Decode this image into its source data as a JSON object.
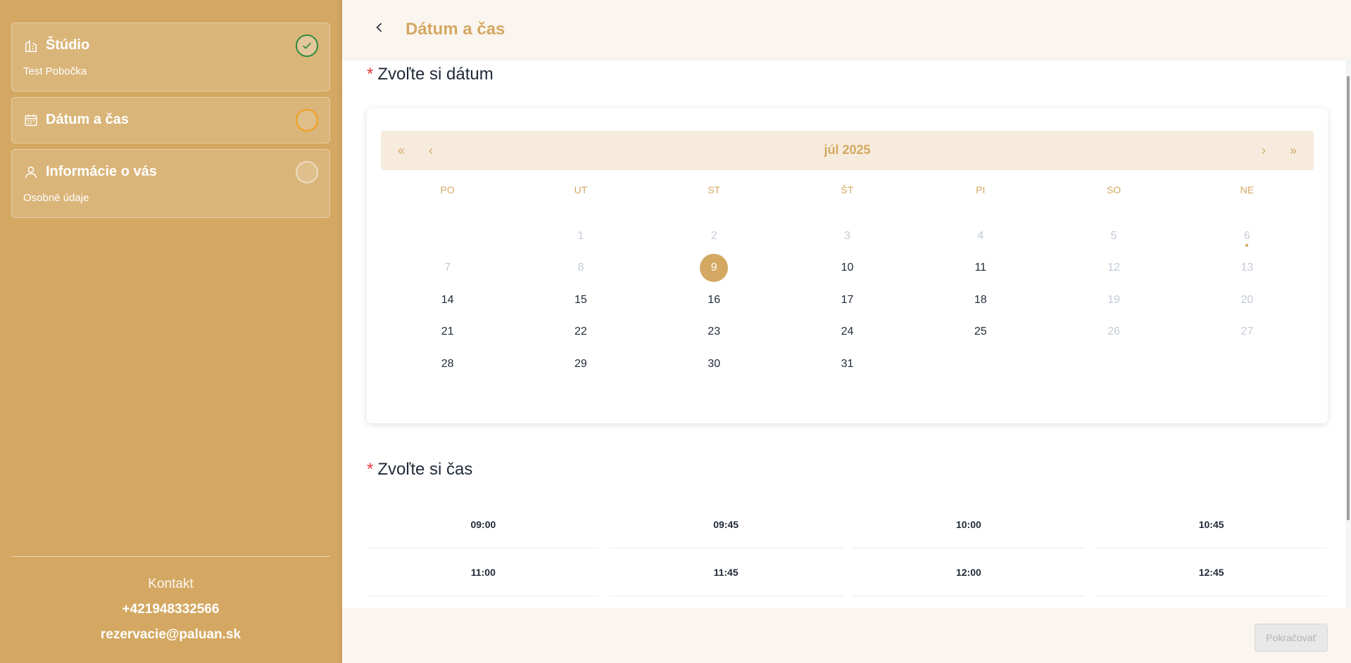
{
  "sidebar": {
    "steps": [
      {
        "title": "Štúdio",
        "subtitle": "Test Pobočka",
        "icon": "building-icon",
        "status": "done"
      },
      {
        "title": "Dátum a čas",
        "subtitle": "",
        "icon": "calendar-icon",
        "status": "active"
      },
      {
        "title": "Informácie o vás",
        "subtitle": "Osobné údaje",
        "icon": "user-icon",
        "status": "todo"
      }
    ],
    "contact": {
      "title": "Kontakt",
      "phone": "+421948332566",
      "email": "rezervacie@paluan.sk"
    }
  },
  "header": {
    "title": "Dátum a čas",
    "back_icon": "chevron-left-icon"
  },
  "date_section": {
    "required_mark": "*",
    "label": "Zvoľte si dátum"
  },
  "calendar": {
    "month_label": "júl 2025",
    "nav": {
      "prev_year": "«",
      "prev_month": "‹",
      "next_month": "›",
      "next_year": "»"
    },
    "weekdays": [
      "PO",
      "UT",
      "ST",
      "ŠT",
      "PI",
      "SO",
      "NE"
    ],
    "days": [
      {
        "label": "",
        "state": "empty"
      },
      {
        "label": "1",
        "state": "disabled"
      },
      {
        "label": "2",
        "state": "disabled"
      },
      {
        "label": "3",
        "state": "disabled"
      },
      {
        "label": "4",
        "state": "disabled"
      },
      {
        "label": "5",
        "state": "disabled"
      },
      {
        "label": "6",
        "state": "disabled",
        "today": true
      },
      {
        "label": "7",
        "state": "disabled"
      },
      {
        "label": "8",
        "state": "disabled"
      },
      {
        "label": "9",
        "state": "selected"
      },
      {
        "label": "10",
        "state": "available"
      },
      {
        "label": "11",
        "state": "available"
      },
      {
        "label": "12",
        "state": "disabled"
      },
      {
        "label": "13",
        "state": "disabled"
      },
      {
        "label": "14",
        "state": "available"
      },
      {
        "label": "15",
        "state": "available"
      },
      {
        "label": "16",
        "state": "available"
      },
      {
        "label": "17",
        "state": "available"
      },
      {
        "label": "18",
        "state": "available"
      },
      {
        "label": "19",
        "state": "disabled"
      },
      {
        "label": "20",
        "state": "disabled"
      },
      {
        "label": "21",
        "state": "available"
      },
      {
        "label": "22",
        "state": "available"
      },
      {
        "label": "23",
        "state": "available"
      },
      {
        "label": "24",
        "state": "available"
      },
      {
        "label": "25",
        "state": "available"
      },
      {
        "label": "26",
        "state": "disabled"
      },
      {
        "label": "27",
        "state": "disabled"
      },
      {
        "label": "28",
        "state": "available"
      },
      {
        "label": "29",
        "state": "available"
      },
      {
        "label": "30",
        "state": "available"
      },
      {
        "label": "31",
        "state": "available"
      }
    ]
  },
  "time_section": {
    "required_mark": "*",
    "label": "Zvoľte si čas",
    "slots": [
      "09:00",
      "09:45",
      "10:00",
      "10:45",
      "11:00",
      "11:45",
      "12:00",
      "12:45"
    ]
  },
  "footer": {
    "continue_label": "Pokračovať",
    "continue_enabled": false
  },
  "colors": {
    "brand": "#d4a862",
    "done": "#2e8b3e",
    "active": "#f0a020",
    "required": "#e53935"
  }
}
